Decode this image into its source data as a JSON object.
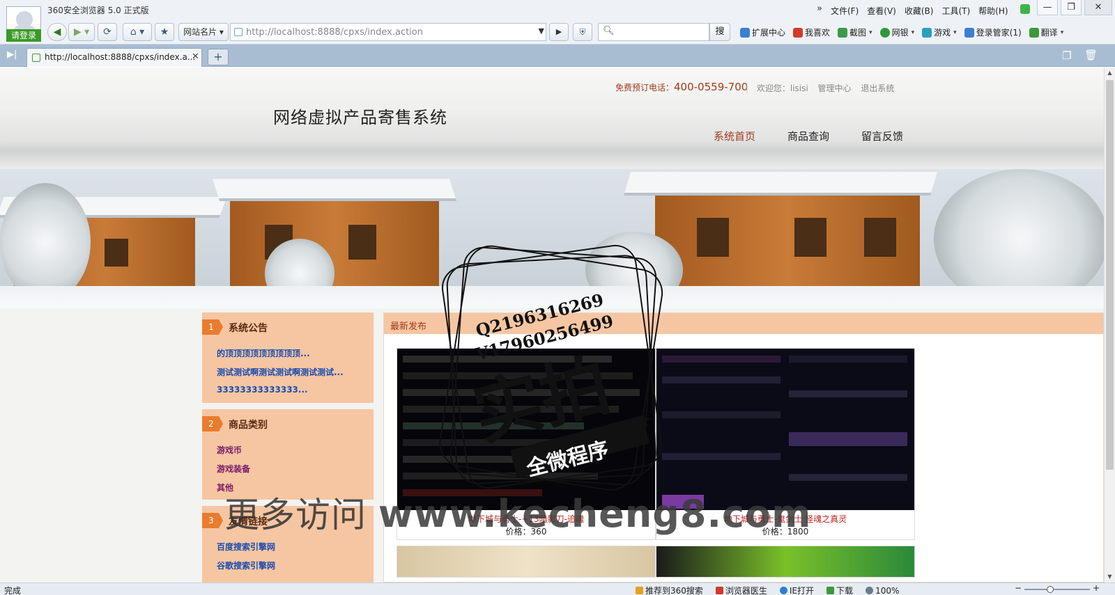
{
  "browser": {
    "app_title": "360安全浏览器 5.0 正式版",
    "login_label": "请登录",
    "menu": [
      "文件(F)",
      "查看(V)",
      "收藏(B)",
      "工具(T)",
      "帮助(H)"
    ],
    "sites_label": "网站名片",
    "address": "http://localhost:8888/cpxs/index.action",
    "search_label": "搜",
    "plugins": [
      {
        "label": "扩展中心",
        "color": "#3b7fd0"
      },
      {
        "label": "我喜欢",
        "color": "#d23a2a"
      },
      {
        "label": "截图",
        "color": "#3a9a4a"
      },
      {
        "label": "网银",
        "color": "#2d9a3a"
      },
      {
        "label": "游戏",
        "color": "#2aa0c0"
      },
      {
        "label": "登录管家(1)",
        "color": "#3b7fd0"
      },
      {
        "label": "翻译",
        "color": "#3a9a3a"
      }
    ],
    "tab_title": "http://localhost:8888/cpxs/index.a...",
    "status": "完成",
    "status_items": [
      {
        "label": "推荐到360搜索",
        "color": "#e8a020"
      },
      {
        "label": "浏览器医生",
        "color": "#d23a2a"
      },
      {
        "label": "IE打开",
        "color": "#2a80d0"
      },
      {
        "label": "下载",
        "color": "#3a9a3a"
      }
    ],
    "zoom": "100%"
  },
  "site": {
    "hotline_label": "免费预订电话：",
    "hotline_number": "400-0559-700",
    "welcome": "欢迎您：lisisi",
    "admin_link": "管理中心",
    "logout_link": "退出系统",
    "title": "网络虚拟产品寄售系统",
    "nav": [
      "系统首页",
      "商品查询",
      "留言反馈"
    ],
    "announcements": {
      "num": "1",
      "title": "系统公告",
      "items": [
        "的顶顶顶顶顶顶顶顶顶...",
        "测试测试啊测试测试啊测试测试...",
        "33333333333333..."
      ]
    },
    "categories": {
      "num": "2",
      "title": "商品类别",
      "items": [
        "游戏币",
        "游戏装备",
        "其他"
      ]
    },
    "links": {
      "num": "3",
      "title": "友情链接",
      "items": [
        "百度搜索引擎网",
        "谷歌搜索引擎网"
      ]
    },
    "latest_title": "最新发布",
    "products": [
      {
        "name": "地下城与勇士-+13暗影刀-追魂",
        "price_label": "价格：",
        "price": "360"
      },
      {
        "name": "地下城与勇士-鬼剑士 怪魂之真灵",
        "price_label": "价格：",
        "price": "1800"
      }
    ]
  },
  "watermark": {
    "stamp_line1": "Q2196316269",
    "stamp_line2": "V17960256499",
    "stamp_big": "实拍",
    "stamp_ribbon": "全微程序",
    "footer_prefix": "更多访问",
    "footer_url": "www.kecheng8.com"
  }
}
